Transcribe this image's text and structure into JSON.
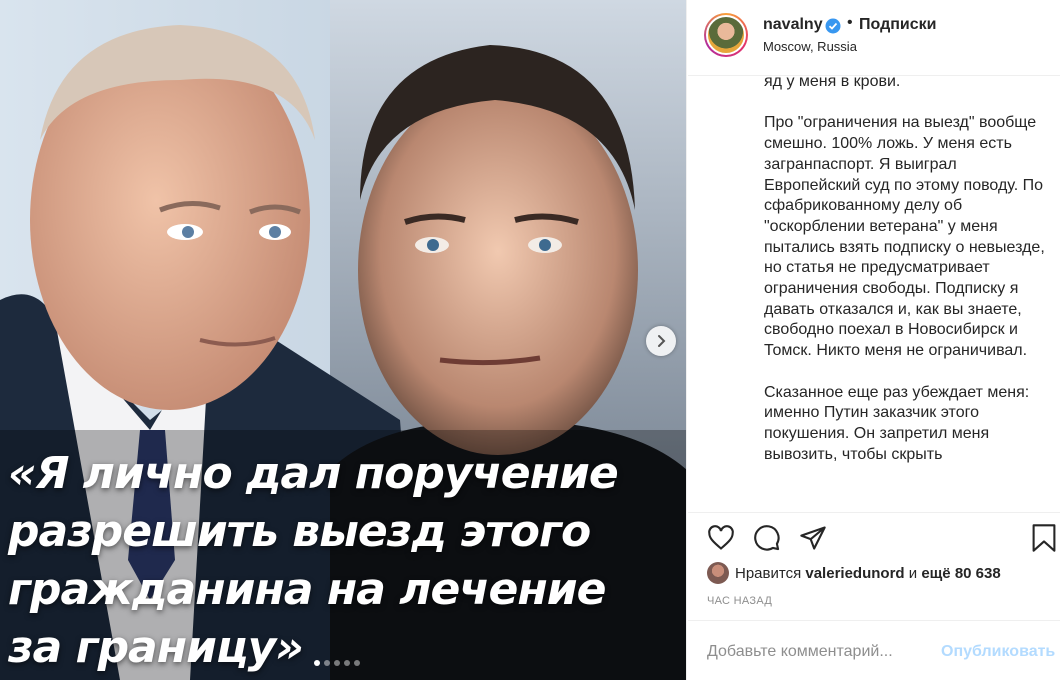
{
  "post": {
    "quote_lines": [
      "«Я лично дал поручение",
      "разрешить выезд этого",
      "гражданина на лечение",
      "за границу»"
    ],
    "carousel": {
      "total": 5,
      "active": 1
    }
  },
  "header": {
    "username": "navalny",
    "separator": "•",
    "follow_label": "Подписки",
    "location": "Moscow, Russia"
  },
  "caption": {
    "paragraphs": [
      "яд у меня в крови.",
      "Про \"ограничения на выезд\" вообще смешно. 100% ложь. У меня есть загранпаспорт. Я выиграл Европейский суд по этому поводу. По сфабрикованному делу об \"оскорблении ветерана\" у меня пытались взять подписку о невыезде, но статья не предусматривает ограничения свободы. Подписку я давать отказался и, как вы знаете, свободно поехал в Новосибирск и Томск. Никто меня не ограничивал.",
      "Сказанное еще раз убеждает меня: именно Путин заказчик этого покушения. Он запретил меня вывозить, чтобы скрыть"
    ]
  },
  "likes": {
    "prefix": "Нравится",
    "user": "valeriedunord",
    "middle": "и",
    "rest": "ещё 80 638"
  },
  "time_label": "ЧАС НАЗАД",
  "comment": {
    "placeholder": "Добавьте комментарий...",
    "publish_label": "Опубликовать"
  },
  "colors": {
    "verified": "#3897f0",
    "publish_disabled": "#b3dbff",
    "muted_text": "#8e8e8e"
  }
}
